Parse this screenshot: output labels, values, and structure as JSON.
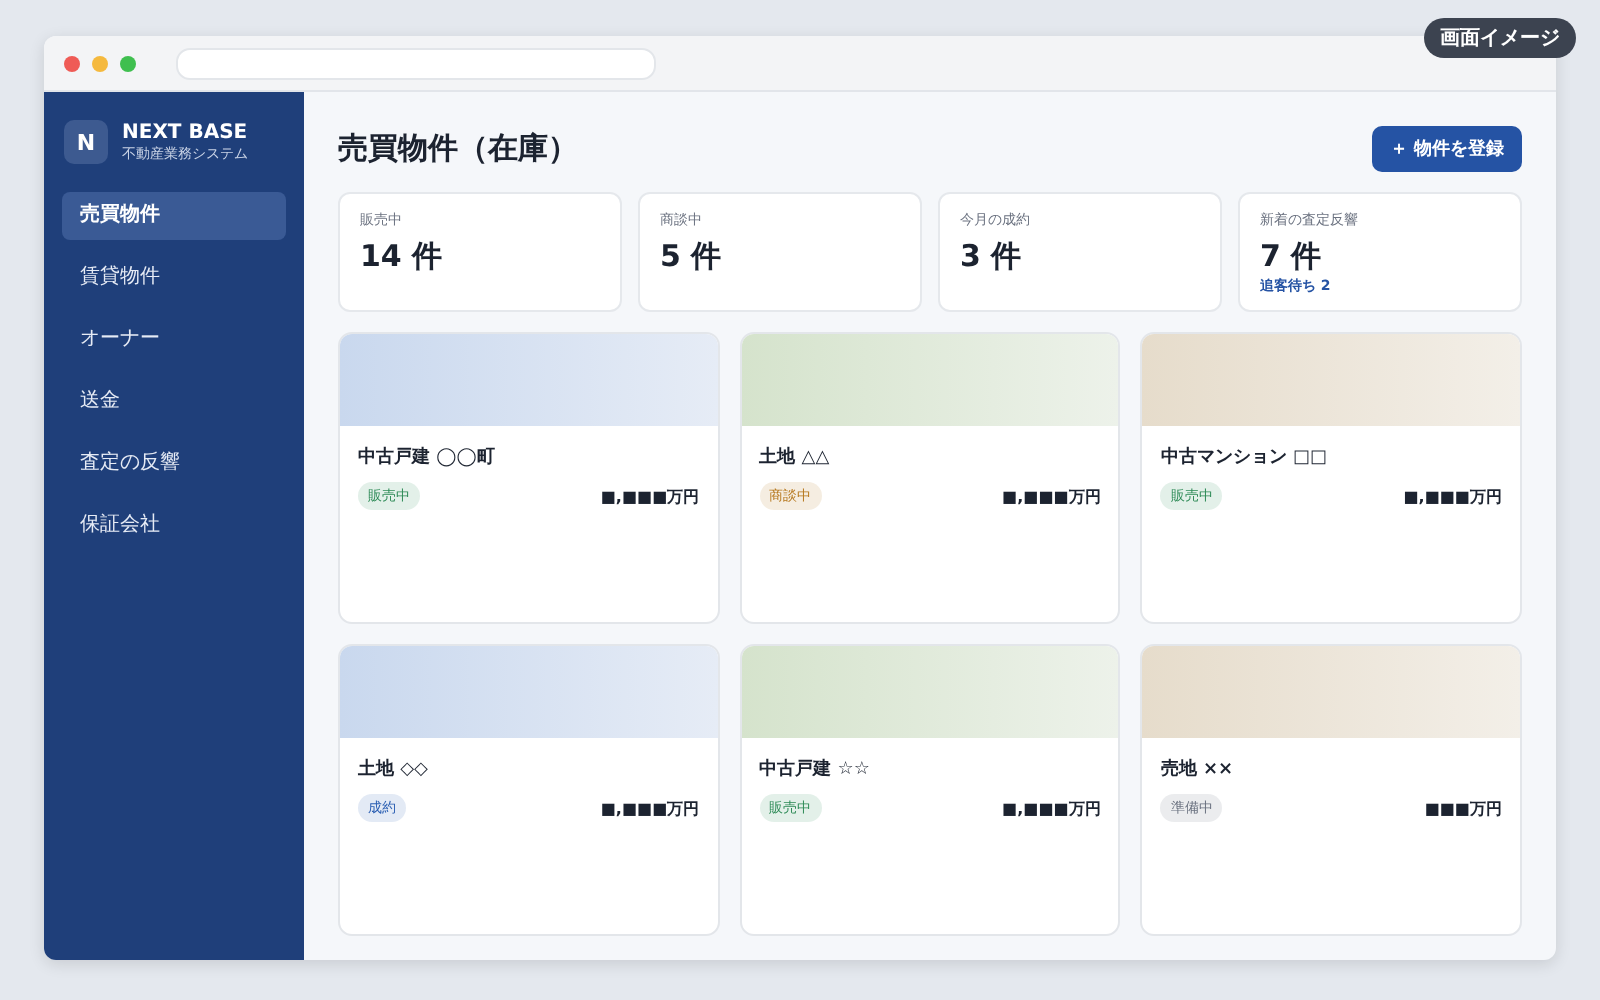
{
  "image_label": "画面イメージ",
  "brand": {
    "logo": "N",
    "name": "NEXT BASE",
    "subtitle": "不動産業務システム"
  },
  "sidebar": {
    "items": [
      {
        "label": "売買物件",
        "selected": true
      },
      {
        "label": "賃貸物件",
        "selected": false
      },
      {
        "label": "オーナー",
        "selected": false
      },
      {
        "label": "送金",
        "selected": false
      },
      {
        "label": "査定の反響",
        "selected": false
      },
      {
        "label": "保証会社",
        "selected": false
      }
    ]
  },
  "page_title": "売買物件（在庫）",
  "add_button": "＋ 物件を登録",
  "stats": [
    {
      "label": "販売中",
      "value": "14 件"
    },
    {
      "label": "商談中",
      "value": "5 件"
    },
    {
      "label": "今月の成約",
      "value": "3 件"
    },
    {
      "label": "新着の査定反響",
      "value": "7 件",
      "note": "追客待ち 2"
    }
  ],
  "properties": [
    {
      "name": "中古戸建 ◯◯町",
      "status": "販売中",
      "color": "#2e8b57",
      "price": "■,■■■万円"
    },
    {
      "name": "土地 △△",
      "status": "商談中",
      "color": "#b7791f",
      "price": "■,■■■万円"
    },
    {
      "name": "中古マンション □□",
      "status": "販売中",
      "color": "#2e8b57",
      "price": "■,■■■万円"
    },
    {
      "name": "土地 ◇◇",
      "status": "成約",
      "color": "#2b5fb3",
      "price": "■,■■■万円"
    },
    {
      "name": "中古戸建 ☆☆",
      "status": "販売中",
      "color": "#2e8b57",
      "price": "■,■■■万円"
    },
    {
      "name": "売地 ××",
      "status": "準備中",
      "color": "#6b7280",
      "price": "■■■万円"
    }
  ]
}
